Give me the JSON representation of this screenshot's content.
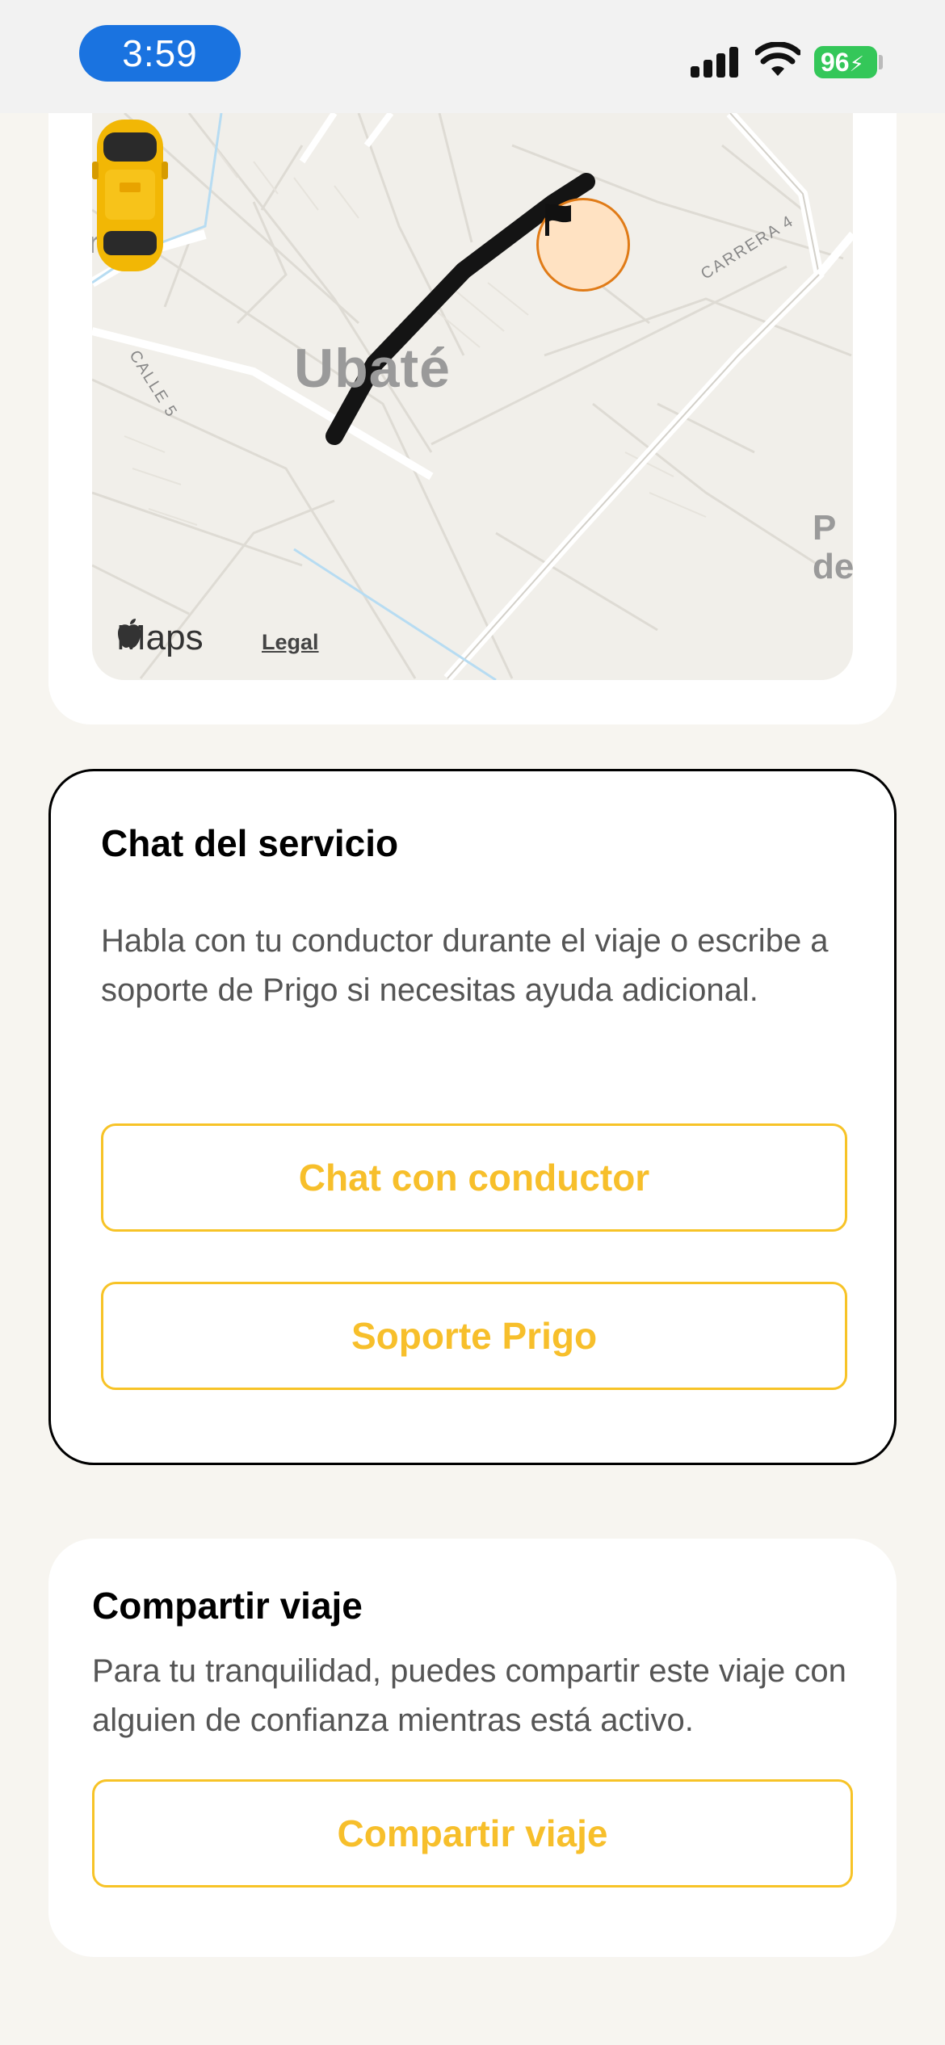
{
  "status_bar": {
    "time": "3:59",
    "battery": "96"
  },
  "map": {
    "city": "Ubaté",
    "street_calle": "CALLE 5",
    "street_carrera": "CARRERA 4",
    "edge_left": "n",
    "edge_right": "P de",
    "maps_label": "Maps",
    "legal_label": "Legal",
    "icons": [
      "flag-icon",
      "taxi-icon",
      "apple-icon"
    ]
  },
  "chat": {
    "title": "Chat del servicio",
    "description": "Habla con tu conductor durante el viaje o escribe a soporte de Prigo si necesitas ayuda adicional.",
    "driver_button": "Chat con conductor",
    "support_button": "Soporte Prigo"
  },
  "share": {
    "title": "Compartir viaje",
    "description": "Para tu tranquilidad, puedes compartir este viaje con alguien de confianza mientras está activo.",
    "button": "Compartir viaje"
  },
  "colors": {
    "accent": "#f7c327",
    "time_pill": "#1a73e0",
    "battery": "#34c759",
    "route": "#141414",
    "flag_marker": "#ffe2c2"
  }
}
